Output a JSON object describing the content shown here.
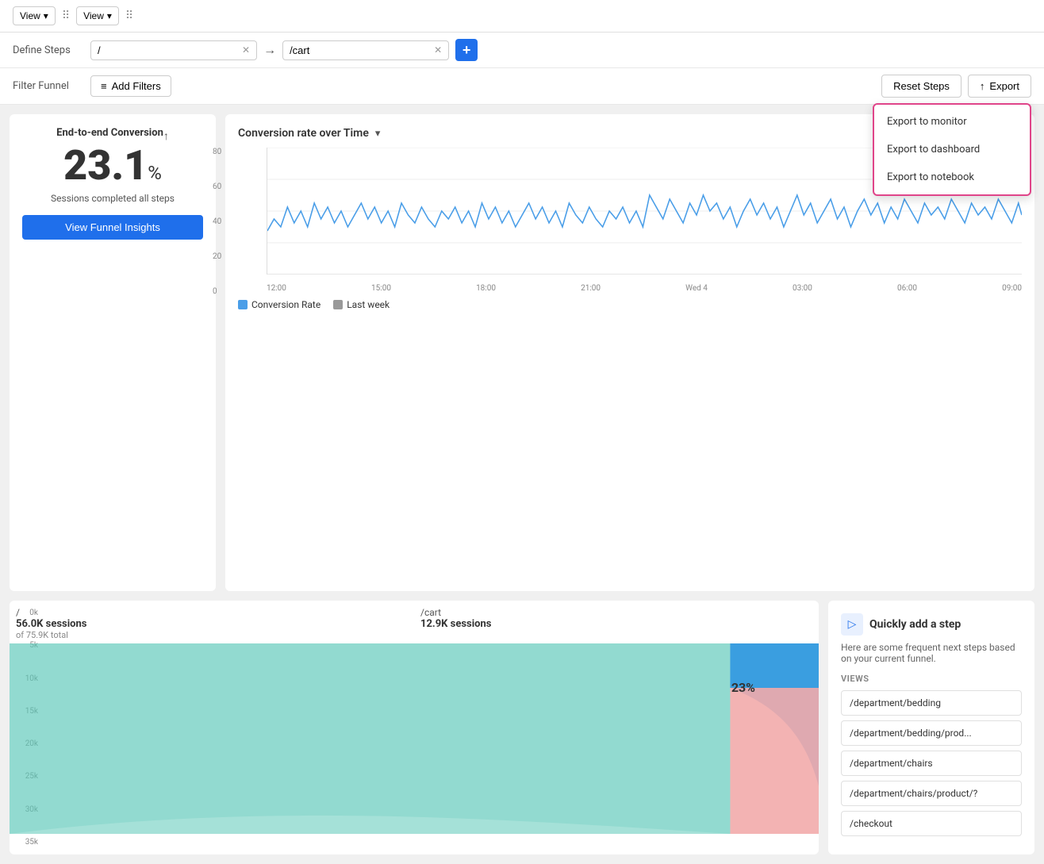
{
  "topbar": {
    "view_label": "View",
    "drag_handle": "⠿"
  },
  "define_steps": {
    "label": "Define Steps",
    "step1_value": "/",
    "step2_value": "/cart",
    "clear_icon": "✕",
    "arrow": "→",
    "add_icon": "+"
  },
  "filter_funnel": {
    "label": "Filter Funnel",
    "add_filter_label": "Add Filters",
    "filter_icon": "≡"
  },
  "actions": {
    "reset_label": "Reset Steps",
    "export_label": "Export",
    "export_icon": "↑"
  },
  "export_dropdown": {
    "visible": true,
    "items": [
      "Export to monitor",
      "Export to dashboard",
      "Export to notebook"
    ]
  },
  "left_panel": {
    "title": "End-to-end Conversion",
    "conversion_value": "23.1",
    "conversion_unit": "%",
    "sessions_text": "Sessions completed all steps",
    "insights_btn": "View Funnel Insights"
  },
  "chart": {
    "title": "Conversion rate over Time",
    "dropdown_icon": "▾",
    "y_labels": [
      "80",
      "60",
      "40",
      "20",
      "0"
    ],
    "x_labels": [
      "12:00",
      "15:00",
      "18:00",
      "21:00",
      "Wed 4",
      "03:00",
      "06:00",
      "09:00"
    ],
    "legend": [
      {
        "label": "Conversion Rate",
        "color": "#4a9ee8"
      },
      {
        "label": "Last week",
        "color": "#999"
      }
    ]
  },
  "funnel": {
    "step1": {
      "name": "/",
      "sessions": "56.0K sessions",
      "total": "of 75.9K total"
    },
    "step2": {
      "name": "/cart",
      "sessions": "12.9K sessions",
      "total": ""
    },
    "pct": "23%",
    "y_labels": [
      "0k",
      "5k",
      "10k",
      "15k",
      "20k",
      "25k",
      "30k",
      "35k"
    ]
  },
  "quick_add": {
    "title": "Quickly add a step",
    "desc": "Here are some frequent next steps based on your current funnel.",
    "views_label": "VIEWS",
    "items": [
      "/department/bedding",
      "/department/bedding/prod...",
      "/department/chairs",
      "/department/chairs/product/?",
      "/checkout"
    ]
  }
}
